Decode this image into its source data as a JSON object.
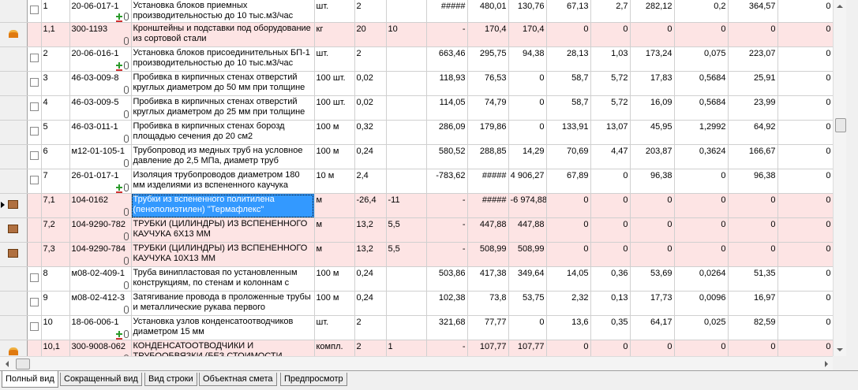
{
  "rows": [
    {
      "num": "1",
      "code": "20-06-017-1",
      "name": "Установка блоков приемных производительностью до 10 тыс.м3/час",
      "unit": "шт.",
      "qty": "2",
      "c1": "",
      "c2": "#####",
      "c3": "480,01",
      "c4": "130,76",
      "c5": "67,13",
      "c6": "2,7",
      "c7": "282,12",
      "c8": "0,2",
      "c9": "364,57",
      "c10": "0"
    },
    {
      "num": "1,1",
      "code": "300-1193",
      "name": "Кронштейны и подставки под оборудование из сортовой стали",
      "unit": "кг",
      "qty": "20",
      "c1": "10",
      "c2": "-",
      "c3": "170,4",
      "c4": "170,4",
      "c5": "0",
      "c6": "0",
      "c7": "0",
      "c8": "0",
      "c9": "0",
      "c10": "0"
    },
    {
      "num": "2",
      "code": "20-06-016-1",
      "name": "Установка блоков присоединительных БП-1 производительностью до 10 тыс.м3/час",
      "unit": "шт.",
      "qty": "2",
      "c1": "",
      "c2": "663,46",
      "c3": "295,75",
      "c4": "94,38",
      "c5": "28,13",
      "c6": "1,03",
      "c7": "173,24",
      "c8": "0,075",
      "c9": "223,07",
      "c10": "0"
    },
    {
      "num": "3",
      "code": "46-03-009-8",
      "name": "Пробивка в кирпичных стенах отверстий круглых диаметром до 50 мм при толщине",
      "unit": "100 шт.",
      "qty": "0,02",
      "c1": "",
      "c2": "118,93",
      "c3": "76,53",
      "c4": "0",
      "c5": "58,7",
      "c6": "5,72",
      "c7": "17,83",
      "c8": "0,5684",
      "c9": "25,91",
      "c10": "0"
    },
    {
      "num": "4",
      "code": "46-03-009-5",
      "name": "Пробивка в кирпичных стенах отверстий круглых диаметром до 25 мм при толщине",
      "unit": "100 шт.",
      "qty": "0,02",
      "c1": "",
      "c2": "114,05",
      "c3": "74,79",
      "c4": "0",
      "c5": "58,7",
      "c6": "5,72",
      "c7": "16,09",
      "c8": "0,5684",
      "c9": "23,99",
      "c10": "0"
    },
    {
      "num": "5",
      "code": "46-03-011-1",
      "name": "Пробивка в кирпичных стенах борозд площадью сечения до 20 см2",
      "unit": "100 м",
      "qty": "0,32",
      "c1": "",
      "c2": "286,09",
      "c3": "179,86",
      "c4": "0",
      "c5": "133,91",
      "c6": "13,07",
      "c7": "45,95",
      "c8": "1,2992",
      "c9": "64,92",
      "c10": "0"
    },
    {
      "num": "6",
      "code": "м12-01-105-1",
      "name": "Трубопровод из медных труб на условное давление до 2,5 МПа, диаметр труб",
      "unit": "100 м",
      "qty": "0,24",
      "c1": "",
      "c2": "580,52",
      "c3": "288,85",
      "c4": "14,29",
      "c5": "70,69",
      "c6": "4,47",
      "c7": "203,87",
      "c8": "0,3624",
      "c9": "166,67",
      "c10": "0"
    },
    {
      "num": "7",
      "code": "26-01-017-1",
      "name": "Изоляция трубопроводов диаметром 180 мм изделиями из вспененного каучука",
      "unit": "10 м",
      "qty": "2,4",
      "c1": "",
      "c2": "-783,62",
      "c3": "#####",
      "c4": "4 906,27",
      "c5": "67,89",
      "c6": "0",
      "c7": "96,38",
      "c8": "0",
      "c9": "96,38",
      "c10": "0"
    },
    {
      "num": "7,1",
      "code": "104-0162",
      "name": "Трубки из вспененного политилена (пенополиэтилен) \"Термафлекс\"",
      "unit": "м",
      "qty": "-26,4",
      "c1": "-11",
      "c2": "-",
      "c3": "#####",
      "c4": "-6 974,88",
      "c5": "0",
      "c6": "0",
      "c7": "0",
      "c8": "0",
      "c9": "0",
      "c10": "0"
    },
    {
      "num": "7,2",
      "code": "104-9290-782",
      "name": "ТРУБКИ (ЦИЛИНДРЫ) ИЗ ВСПЕНЕННОГО КАУЧУКА 6Х13 ММ",
      "unit": "м",
      "qty": "13,2",
      "c1": "5,5",
      "c2": "-",
      "c3": "447,88",
      "c4": "447,88",
      "c5": "0",
      "c6": "0",
      "c7": "0",
      "c8": "0",
      "c9": "0",
      "c10": "0"
    },
    {
      "num": "7,3",
      "code": "104-9290-784",
      "name": "ТРУБКИ (ЦИЛИНДРЫ) ИЗ ВСПЕНЕННОГО КАУЧУКА 10Х13 ММ",
      "unit": "м",
      "qty": "13,2",
      "c1": "5,5",
      "c2": "-",
      "c3": "508,99",
      "c4": "508,99",
      "c5": "0",
      "c6": "0",
      "c7": "0",
      "c8": "0",
      "c9": "0",
      "c10": "0"
    },
    {
      "num": "8",
      "code": "м08-02-409-1",
      "name": "Труба винипластовая по установленным конструкциям, по стенам и колоннам с",
      "unit": "100 м",
      "qty": "0,24",
      "c1": "",
      "c2": "503,86",
      "c3": "417,38",
      "c4": "349,64",
      "c5": "14,05",
      "c6": "0,36",
      "c7": "53,69",
      "c8": "0,0264",
      "c9": "51,35",
      "c10": "0"
    },
    {
      "num": "9",
      "code": "м08-02-412-3",
      "name": "Затягивание провода в проложенные трубы и металлические рукава первого",
      "unit": "100 м",
      "qty": "0,24",
      "c1": "",
      "c2": "102,38",
      "c3": "73,8",
      "c4": "53,75",
      "c5": "2,32",
      "c6": "0,13",
      "c7": "17,73",
      "c8": "0,0096",
      "c9": "16,97",
      "c10": "0"
    },
    {
      "num": "10",
      "code": "18-06-006-1",
      "name": "Установка узлов конденсатоотводчиков диаметром 15 мм",
      "unit": "шт.",
      "qty": "2",
      "c1": "",
      "c2": "321,68",
      "c3": "77,77",
      "c4": "0",
      "c5": "13,6",
      "c6": "0,35",
      "c7": "64,17",
      "c8": "0,025",
      "c9": "82,59",
      "c10": "0"
    },
    {
      "num": "10,1",
      "code": "300-9008-062",
      "name": "КОНДЕНСАТООТВОДЧИКИ И ТРУБООБВЯЗКИ (БЕЗ СТОИМОСТИ",
      "unit": "компл.",
      "qty": "2",
      "c1": "1",
      "c2": "-",
      "c3": "107,77",
      "c4": "107,77",
      "c5": "0",
      "c6": "0",
      "c7": "0",
      "c8": "0",
      "c9": "0",
      "c10": "0"
    }
  ],
  "tabs": {
    "full": "Полный вид",
    "short": "Сокращенный вид",
    "row": "Вид строки",
    "object": "Объектная смета",
    "preview": "Предпросмотр"
  }
}
